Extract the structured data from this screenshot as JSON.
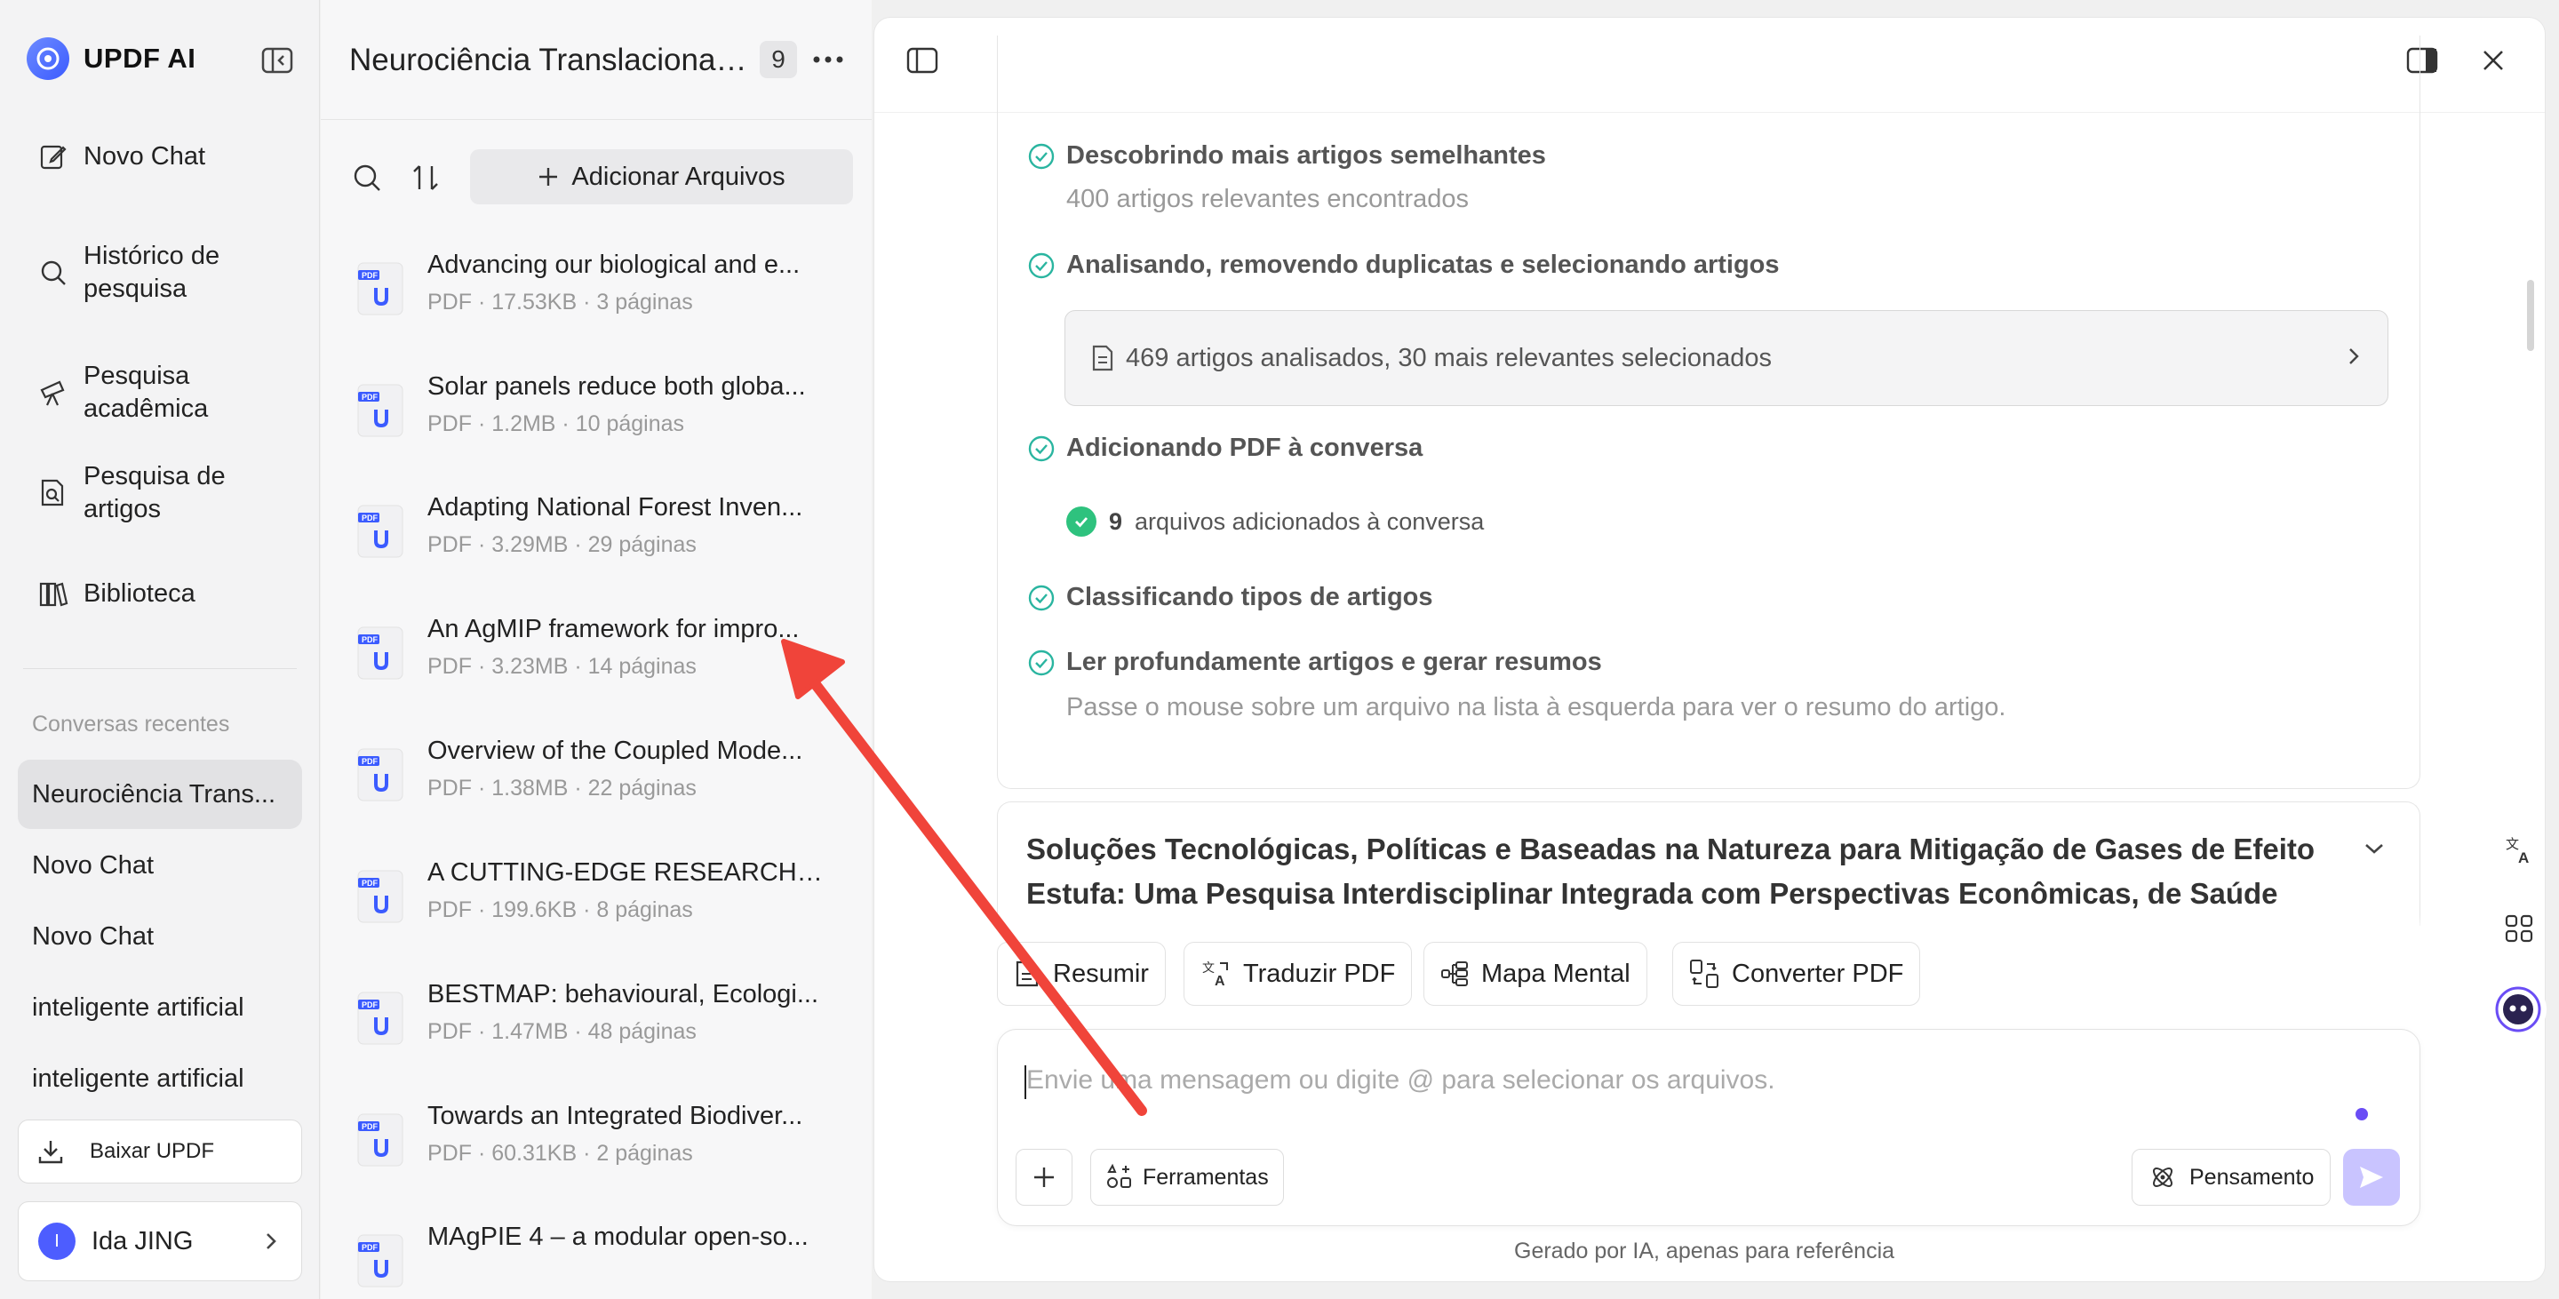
{
  "app": {
    "name": "UPDF AI"
  },
  "sidebar": {
    "nav": [
      {
        "label": "Novo Chat",
        "icon": "edit-icon"
      },
      {
        "label": "Histórico de pesquisa",
        "icon": "search-icon"
      },
      {
        "label": "Pesquisa acadêmica",
        "icon": "telescope-icon"
      },
      {
        "label": "Pesquisa de artigos",
        "icon": "doc-search-icon"
      },
      {
        "label": "Biblioteca",
        "icon": "library-icon"
      }
    ],
    "recent_heading": "Conversas recentes",
    "recent": [
      "Neurociência Trans...",
      "Novo Chat",
      "Novo Chat",
      "inteligente artificial",
      "inteligente artificial"
    ],
    "download_label": "Baixar UPDF",
    "user": {
      "initial": "I",
      "name": "Ida JING"
    }
  },
  "files_panel": {
    "title": "Neurociência Translacional ...",
    "count": "9",
    "add_files_label": "Adicionar Arquivos",
    "files": [
      {
        "name": "Advancing our biological and e...",
        "meta": "PDF · 17.53KB · 3 páginas"
      },
      {
        "name": "Solar panels reduce both globa...",
        "meta": "PDF · 1.2MB · 10 páginas"
      },
      {
        "name": "Adapting National Forest Inven...",
        "meta": "PDF · 3.29MB · 29 páginas"
      },
      {
        "name": "An AgMIP framework for impro...",
        "meta": "PDF · 3.23MB · 14 páginas"
      },
      {
        "name": "Overview of the Coupled Mode...",
        "meta": "PDF · 1.38MB · 22 páginas"
      },
      {
        "name": "A CUTTING-EDGE RESEARCH O...",
        "meta": "PDF · 199.6KB · 8 páginas"
      },
      {
        "name": "BESTMAP: behavioural, Ecologi...",
        "meta": "PDF · 1.47MB · 48 páginas"
      },
      {
        "name": "Towards an Integrated Biodiver...",
        "meta": "PDF · 60.31KB · 2 páginas"
      },
      {
        "name": "MAgPIE 4 – a modular open-so...",
        "meta": ""
      }
    ]
  },
  "main": {
    "steps": [
      {
        "title": "Descobrindo mais artigos semelhantes",
        "sub": "400 artigos relevantes encontrados"
      },
      {
        "title": "Analisando, removendo duplicatas e selecionando artigos",
        "sub": ""
      },
      {
        "title": "Adicionando PDF à conversa",
        "sub": ""
      },
      {
        "title": "Classificando tipos de artigos",
        "sub": ""
      },
      {
        "title": "Ler profundamente artigos e gerar resumos",
        "sub": "Passe o mouse sobre um arquivo na lista à esquerda para ver o resumo do artigo."
      }
    ],
    "analyzed_text": "469 artigos analisados, 30 mais relevantes selecionados",
    "added_count": "9",
    "added_text": "arquivos adicionados à conversa",
    "research_title": "Soluções Tecnológicas, Políticas e Baseadas na Natureza para Mitigação de Gases de Efeito Estufa: Uma Pesquisa Interdisciplinar Integrada com Perspectivas Econômicas, de Saúde",
    "actions": [
      "Resumir",
      "Traduzir PDF",
      "Mapa Mental",
      "Converter PDF"
    ],
    "input_placeholder": "Envie uma mensagem ou digite @ para selecionar os arquivos.",
    "tools_label": "Ferramentas",
    "thinking_label": "Pensamento",
    "footer_note": "Gerado por IA, apenas para referência"
  },
  "colors": {
    "accent": "#6a4df5",
    "check": "#2ab5a0",
    "success": "#2ec27e",
    "arrow": "#f0443a"
  }
}
